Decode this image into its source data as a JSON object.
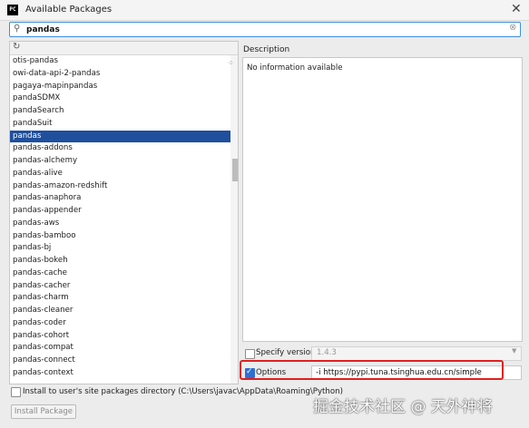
{
  "window": {
    "title": "Available Packages"
  },
  "search": {
    "value": "pandas"
  },
  "packages": [
    "otis-pandas",
    "owi-data-api-2-pandas",
    "pagaya-mapinpandas",
    "pandaSDMX",
    "pandaSearch",
    "pandaSuit",
    "pandas",
    "pandas-addons",
    "pandas-alchemy",
    "pandas-alive",
    "pandas-amazon-redshift",
    "pandas-anaphora",
    "pandas-appender",
    "pandas-aws",
    "pandas-bamboo",
    "pandas-bj",
    "pandas-bokeh",
    "pandas-cache",
    "pandas-cacher",
    "pandas-charm",
    "pandas-cleaner",
    "pandas-coder",
    "pandas-cohort",
    "pandas-compat",
    "pandas-connect",
    "pandas-context"
  ],
  "selected_package": "pandas",
  "description": {
    "label": "Description",
    "text": "No information available"
  },
  "specify_version": {
    "label": "Specify version",
    "value": "1.4.3",
    "checked": false
  },
  "options": {
    "label": "Options",
    "value": "-i https://pypi.tuna.tsinghua.edu.cn/simple",
    "checked": true
  },
  "install_user": {
    "label": "Install to user's site packages directory (C:\\Users\\javac\\AppData\\Roaming\\Python)",
    "checked": false
  },
  "install_button": {
    "label": "Install Package"
  },
  "watermark": {
    "text": "掘金技术社区 @ 天外神将"
  },
  "colors": {
    "selection": "#1f4f9d",
    "annotation": "#e02020",
    "accent": "#3d8ee0"
  }
}
